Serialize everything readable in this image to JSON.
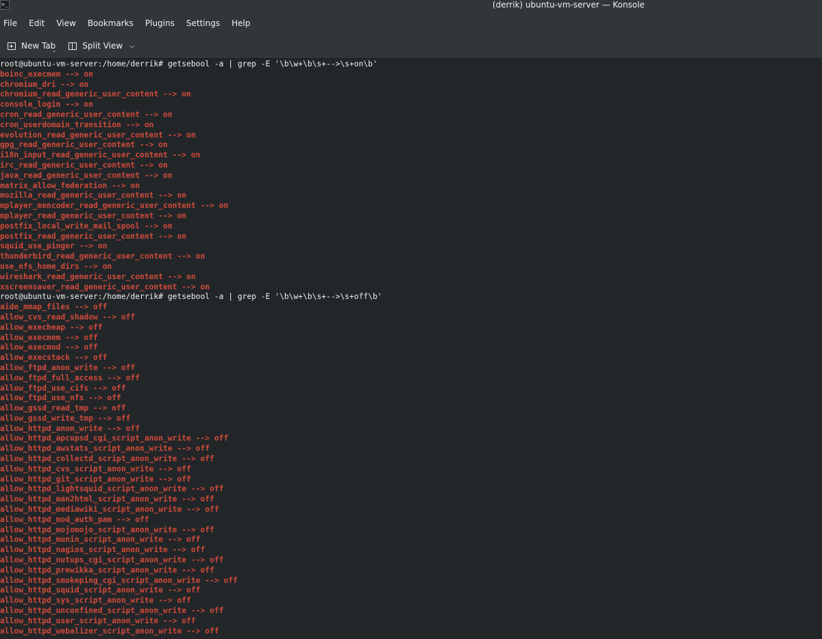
{
  "window": {
    "title": "(derrik) ubuntu-vm-server — Konsole",
    "icon": ">_"
  },
  "menu": [
    "File",
    "Edit",
    "View",
    "Bookmarks",
    "Plugins",
    "Settings",
    "Help"
  ],
  "toolbar": {
    "new_tab": "New Tab",
    "split_view": "Split View"
  },
  "colors": {
    "background": "#232629",
    "output": "#d04a3a",
    "prompt": "#eff0f1"
  },
  "terminal": {
    "lines": [
      {
        "type": "prompt",
        "text": "root@ubuntu-vm-server:/home/derrik# getsebool -a | grep -E '\\b\\w+\\b\\s+-->\\s+on\\b'"
      },
      {
        "type": "out",
        "text": "boinc_execmem --> on"
      },
      {
        "type": "out",
        "text": "chromium_dri --> on"
      },
      {
        "type": "out",
        "text": "chromium_read_generic_user_content --> on"
      },
      {
        "type": "out",
        "text": "console_login --> on"
      },
      {
        "type": "out",
        "text": "cron_read_generic_user_content --> on"
      },
      {
        "type": "out",
        "text": "cron_userdomain_transition --> on"
      },
      {
        "type": "out",
        "text": "evolution_read_generic_user_content --> on"
      },
      {
        "type": "out",
        "text": "gpg_read_generic_user_content --> on"
      },
      {
        "type": "out",
        "text": "i18n_input_read_generic_user_content --> on"
      },
      {
        "type": "out",
        "text": "irc_read_generic_user_content --> on"
      },
      {
        "type": "out",
        "text": "java_read_generic_user_content --> on"
      },
      {
        "type": "out",
        "text": "matrix_allow_federation --> on"
      },
      {
        "type": "out",
        "text": "mozilla_read_generic_user_content --> on"
      },
      {
        "type": "out",
        "text": "mplayer_mencoder_read_generic_user_content --> on"
      },
      {
        "type": "out",
        "text": "mplayer_read_generic_user_content --> on"
      },
      {
        "type": "out",
        "text": "postfix_local_write_mail_spool --> on"
      },
      {
        "type": "out",
        "text": "postfix_read_generic_user_content --> on"
      },
      {
        "type": "out",
        "text": "squid_use_pinger --> on"
      },
      {
        "type": "out",
        "text": "thunderbird_read_generic_user_content --> on"
      },
      {
        "type": "out",
        "text": "use_nfs_home_dirs --> on"
      },
      {
        "type": "out",
        "text": "wireshark_read_generic_user_content --> on"
      },
      {
        "type": "out",
        "text": "xscreensaver_read_generic_user_content --> on"
      },
      {
        "type": "prompt",
        "text": "root@ubuntu-vm-server:/home/derrik# getsebool -a | grep -E '\\b\\w+\\b\\s+-->\\s+off\\b'"
      },
      {
        "type": "out",
        "text": "aide_mmap_files --> off"
      },
      {
        "type": "out",
        "text": "allow_cvs_read_shadow --> off"
      },
      {
        "type": "out",
        "text": "allow_execheap --> off"
      },
      {
        "type": "out",
        "text": "allow_execmem --> off"
      },
      {
        "type": "out",
        "text": "allow_execmod --> off"
      },
      {
        "type": "out",
        "text": "allow_execstack --> off"
      },
      {
        "type": "out",
        "text": "allow_ftpd_anon_write --> off"
      },
      {
        "type": "out",
        "text": "allow_ftpd_full_access --> off"
      },
      {
        "type": "out",
        "text": "allow_ftpd_use_cifs --> off"
      },
      {
        "type": "out",
        "text": "allow_ftpd_use_nfs --> off"
      },
      {
        "type": "out",
        "text": "allow_gssd_read_tmp --> off"
      },
      {
        "type": "out",
        "text": "allow_gssd_write_tmp --> off"
      },
      {
        "type": "out",
        "text": "allow_httpd_anon_write --> off"
      },
      {
        "type": "out",
        "text": "allow_httpd_apcupsd_cgi_script_anon_write --> off"
      },
      {
        "type": "out",
        "text": "allow_httpd_awstats_script_anon_write --> off"
      },
      {
        "type": "out",
        "text": "allow_httpd_collectd_script_anon_write --> off"
      },
      {
        "type": "out",
        "text": "allow_httpd_cvs_script_anon_write --> off"
      },
      {
        "type": "out",
        "text": "allow_httpd_git_script_anon_write --> off"
      },
      {
        "type": "out",
        "text": "allow_httpd_lightsquid_script_anon_write --> off"
      },
      {
        "type": "out",
        "text": "allow_httpd_man2html_script_anon_write --> off"
      },
      {
        "type": "out",
        "text": "allow_httpd_mediawiki_script_anon_write --> off"
      },
      {
        "type": "out",
        "text": "allow_httpd_mod_auth_pam --> off"
      },
      {
        "type": "out",
        "text": "allow_httpd_mojomojo_script_anon_write --> off"
      },
      {
        "type": "out",
        "text": "allow_httpd_munin_script_anon_write --> off"
      },
      {
        "type": "out",
        "text": "allow_httpd_nagios_script_anon_write --> off"
      },
      {
        "type": "out",
        "text": "allow_httpd_nutups_cgi_script_anon_write --> off"
      },
      {
        "type": "out",
        "text": "allow_httpd_prewikka_script_anon_write --> off"
      },
      {
        "type": "out",
        "text": "allow_httpd_smokeping_cgi_script_anon_write --> off"
      },
      {
        "type": "out",
        "text": "allow_httpd_squid_script_anon_write --> off"
      },
      {
        "type": "out",
        "text": "allow_httpd_sys_script_anon_write --> off"
      },
      {
        "type": "out",
        "text": "allow_httpd_unconfined_script_anon_write --> off"
      },
      {
        "type": "out",
        "text": "allow_httpd_user_script_anon_write --> off"
      },
      {
        "type": "out",
        "text": "allow_httpd_webalizer_script_anon_write --> off"
      }
    ]
  }
}
